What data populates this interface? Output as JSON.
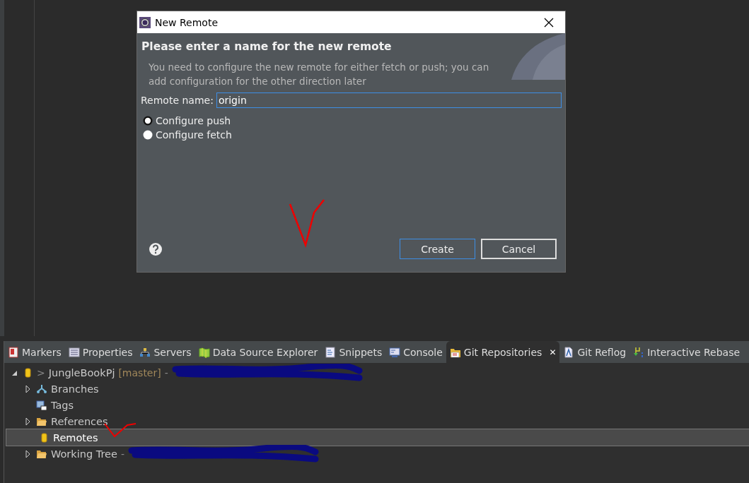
{
  "dialog": {
    "title": "New Remote",
    "heading": "Please enter a name for the new remote",
    "description": "You need to configure the new remote for either fetch or push; you can add configuration for the other direction later",
    "field": {
      "label": "Remote name:",
      "value": "origin"
    },
    "options": [
      {
        "label": "Configure push",
        "selected": true
      },
      {
        "label": "Configure fetch",
        "selected": false
      }
    ],
    "buttons": [
      {
        "label": "Create",
        "kind": "default"
      },
      {
        "label": "Cancel",
        "kind": "normal"
      }
    ]
  },
  "panel": {
    "tabs": [
      {
        "label": "Markers",
        "selected": false
      },
      {
        "label": "Properties",
        "selected": false
      },
      {
        "label": "Servers",
        "selected": false
      },
      {
        "label": "Data Source Explorer",
        "selected": false
      },
      {
        "label": "Snippets",
        "selected": false
      },
      {
        "label": "Console",
        "selected": false
      },
      {
        "label": "Git Repositories",
        "selected": true,
        "close": "✕"
      },
      {
        "label": "Git Reflog",
        "selected": false
      },
      {
        "label": "Interactive Rebase",
        "selected": false
      }
    ],
    "tree": [
      {
        "prefix": ">",
        "label": "JungleBookPj",
        "branch": "[master]",
        "suffix": "-",
        "kind": "repository",
        "expanded": true,
        "selected": false,
        "children": [
          {
            "label": "Branches",
            "kind": "branches",
            "expanded": false,
            "selected": false
          },
          {
            "label": "Tags",
            "kind": "tags",
            "selected": false
          },
          {
            "label": "References",
            "kind": "folder",
            "expanded": false,
            "selected": false
          },
          {
            "label": "Remotes",
            "kind": "repository",
            "selected": true
          },
          {
            "label": "Working Tree",
            "suffix": "-",
            "kind": "folder",
            "expanded": false,
            "selected": false
          }
        ]
      }
    ]
  }
}
